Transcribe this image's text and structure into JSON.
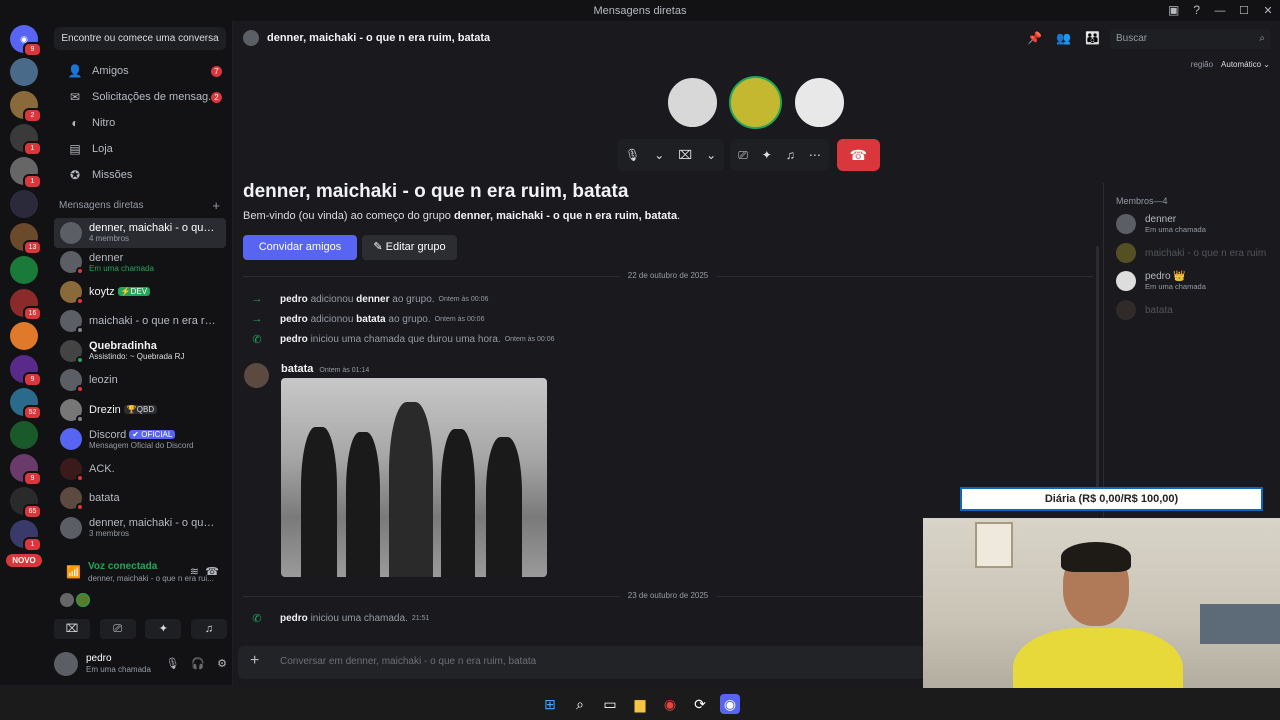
{
  "window": {
    "title": "Mensagens diretas"
  },
  "rail": {
    "badges": [
      "9",
      "",
      "2",
      "1",
      "1",
      "",
      "13",
      "",
      "16",
      "",
      "9",
      "52",
      "",
      "9",
      "65",
      "1",
      ""
    ],
    "novo_label": "NOVO"
  },
  "sidebar": {
    "find_button": "Encontre ou comece uma conversa",
    "nav": [
      {
        "label": "Amigos",
        "count": "7",
        "icon": "friends-icon"
      },
      {
        "label": "Solicitações de mensag...",
        "count": "2",
        "icon": "envelope-icon"
      },
      {
        "label": "Nitro",
        "count": "",
        "icon": "nitro-icon"
      },
      {
        "label": "Loja",
        "count": "",
        "icon": "shop-icon"
      },
      {
        "label": "Missões",
        "count": "",
        "icon": "quests-icon"
      }
    ],
    "dm_header": "Mensagens diretas",
    "dms": [
      {
        "name": "denner, maichaki - o que ...",
        "sub": "4 membros",
        "tag": ""
      },
      {
        "name": "denner",
        "sub": "Em uma chamada",
        "tag": ""
      },
      {
        "name": "koytz",
        "sub": "",
        "tag": "⚡DEV"
      },
      {
        "name": "maichaki - o que n era ruim",
        "sub": "",
        "tag": ""
      },
      {
        "name": "Quebradinha",
        "sub": "Assistindo: ~ Quebrada RJ",
        "tag": ""
      },
      {
        "name": "leozin",
        "sub": "",
        "tag": ""
      },
      {
        "name": "Drezin",
        "sub": "",
        "tag": "🏆QBD"
      },
      {
        "name": "Discord",
        "sub": "Mensagem Oficial do Discord",
        "tag": "✔ OFICIAL"
      },
      {
        "name": "ACK.",
        "sub": "",
        "tag": ""
      },
      {
        "name": "batata",
        "sub": "",
        "tag": ""
      },
      {
        "name": "denner, maichaki - o que ...",
        "sub": "3 membros",
        "tag": ""
      }
    ]
  },
  "voice": {
    "status": "Voz conectada",
    "channel": "denner, maichaki - o que n era rui..."
  },
  "user": {
    "name": "pedro",
    "status": "Em uma chamada"
  },
  "channel": {
    "title": "denner, maichaki - o que n era ruim, batata",
    "search_placeholder": "Buscar",
    "region_label": "região",
    "region_value": "Automático ⌄"
  },
  "group": {
    "title": "denner, maichaki - o que n era ruim, batata",
    "welcome_prefix": "Bem-vindo (ou vinda) ao começo do grupo ",
    "welcome_name": "denner, maichaki - o que n era ruim, batata",
    "welcome_suffix": ".",
    "invite_label": "Convidar amigos",
    "edit_label": "Editar grupo"
  },
  "messages": {
    "date1": "22 de outubro de 2025",
    "date2": "23 de outubro de 2025",
    "sys": [
      {
        "actor": "pedro",
        "text": "adicionou",
        "target": "denner",
        "rest": "ao grupo.",
        "ts": "Ontem às 00:06"
      },
      {
        "actor": "pedro",
        "text": "adicionou",
        "target": "batata",
        "rest": "ao grupo.",
        "ts": "Ontem às 00:06"
      },
      {
        "actor": "pedro",
        "text": "iniciou uma chamada que durou uma hora.",
        "target": "",
        "rest": "",
        "ts": "Ontem às 00:06"
      }
    ],
    "post": {
      "author": "batata",
      "ts": "Ontem às 01:14"
    },
    "call_now": {
      "actor": "pedro",
      "text": "iniciou uma chamada.",
      "ts": "21:51"
    }
  },
  "composer": {
    "placeholder": "Conversar em denner, maichaki - o que n era ruim, batata"
  },
  "members": {
    "header": "Membros—4",
    "list": [
      {
        "name": "denner",
        "sub": "Em uma chamada"
      },
      {
        "name": "maichaki - o que n era ruim",
        "sub": ""
      },
      {
        "name": "pedro 👑",
        "sub": "Em uma chamada"
      },
      {
        "name": "batata",
        "sub": ""
      }
    ]
  },
  "overlay": {
    "text": "Diária (R$ 0,00/R$ 100,00)"
  }
}
